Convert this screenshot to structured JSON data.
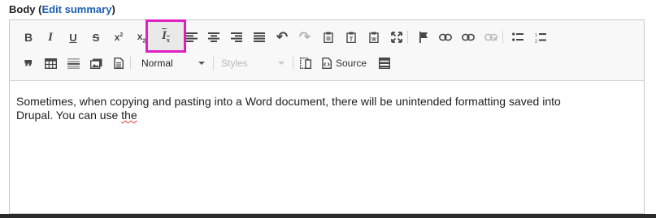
{
  "field": {
    "label": "Body",
    "paren_open": " (",
    "link": "Edit summary",
    "paren_close": ")"
  },
  "toolbar": {
    "row1": [
      {
        "name": "bold-button",
        "glyph": "B",
        "icon": "bold-icon"
      },
      {
        "name": "italic-button",
        "glyph": "I",
        "icon": "italic-icon"
      },
      {
        "name": "underline-button",
        "glyph": "U",
        "icon": "underline-icon"
      },
      {
        "name": "strikethrough-button",
        "glyph": "S",
        "icon": "strikethrough-icon"
      },
      {
        "name": "superscript-button",
        "glyph": "x²",
        "icon": "superscript-icon"
      },
      {
        "name": "subscript-button",
        "glyph": "x₂",
        "icon": "subscript-icon"
      },
      {
        "name": "remove-format-button",
        "glyph": "Iₓ",
        "icon": "remove-format-icon"
      },
      {
        "name": "align-left-button",
        "glyph": "≡",
        "icon": "align-left-icon"
      },
      {
        "name": "align-center-button",
        "glyph": "≡",
        "icon": "align-center-icon"
      },
      {
        "name": "align-right-button",
        "glyph": "≡",
        "icon": "align-right-icon"
      },
      {
        "name": "justify-button",
        "glyph": "≣",
        "icon": "justify-icon"
      },
      {
        "name": "undo-button",
        "glyph": "↶",
        "icon": "undo-icon"
      },
      {
        "name": "redo-button",
        "glyph": "↷",
        "icon": "redo-icon"
      },
      {
        "name": "paste-button",
        "glyph": "📋",
        "icon": "paste-icon"
      },
      {
        "name": "paste-text-button",
        "glyph": "📋",
        "icon": "paste-text-icon"
      },
      {
        "name": "paste-word-button",
        "glyph": "📋",
        "icon": "paste-word-icon"
      },
      {
        "name": "maximize-button",
        "glyph": "⤢",
        "icon": "maximize-icon"
      },
      {
        "name": "anchor-button",
        "glyph": "⚑",
        "icon": "flag-icon"
      },
      {
        "name": "link-button",
        "glyph": "🔗",
        "icon": "link-icon"
      },
      {
        "name": "link-alt-button",
        "glyph": "🔗",
        "icon": "link-icon"
      },
      {
        "name": "unlink-button",
        "glyph": "🔗",
        "icon": "unlink-icon"
      },
      {
        "name": "bulleted-list-button",
        "glyph": "•≡",
        "icon": "bulleted-list-icon"
      },
      {
        "name": "numbered-list-button",
        "glyph": "1≡",
        "icon": "numbered-list-icon"
      }
    ],
    "row2": {
      "blockquote_glyph": "❞",
      "format_value": "Normal",
      "styles_value": "Styles",
      "source_label": "Source"
    }
  },
  "content": {
    "line1": "Sometimes, when copying and pasting into a Word document, there will be unintended formatting saved into",
    "line2_prefix": "Drupal. You can use ",
    "line2_misspelled": "the"
  }
}
